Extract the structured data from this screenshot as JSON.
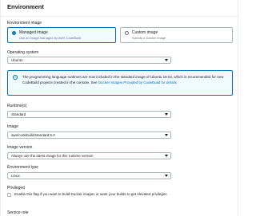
{
  "section": {
    "title": "Environment"
  },
  "environment_image": {
    "label": "Environment image",
    "options": [
      {
        "title": "Managed image",
        "description": "Use an image managed by AWS CodeBuild",
        "selected": true
      },
      {
        "title": "Custom image",
        "description": "Specify a Docker image",
        "selected": false
      }
    ]
  },
  "operating_system": {
    "label": "Operating system",
    "value": "Ubuntu"
  },
  "info_alert": {
    "text": "The programming language runtimes are now included in the standard image of Ubuntu 18.04, which is recommended for new CodeBuild projects created in the console. See ",
    "link": "Docker Images Provided by CodeBuild for details"
  },
  "runtime": {
    "label": "Runtime(s)",
    "value": "Standard"
  },
  "image": {
    "label": "Image",
    "value": "aws/codebuild/standard:6.0"
  },
  "image_version": {
    "label": "Image version",
    "value": "Always use the latest image for this runtime version"
  },
  "environment_type": {
    "label": "Environment type",
    "value": "Linux"
  },
  "privileged": {
    "label": "Privileged",
    "checkbox_text": "Enable this flag if you want to build Docker images or want your builds to get elevated privileges",
    "checked": false
  },
  "service_role": {
    "label": "Service role"
  },
  "colors": {
    "accent": "#0073bb",
    "border": "#aab7b8",
    "text": "#16191f"
  }
}
